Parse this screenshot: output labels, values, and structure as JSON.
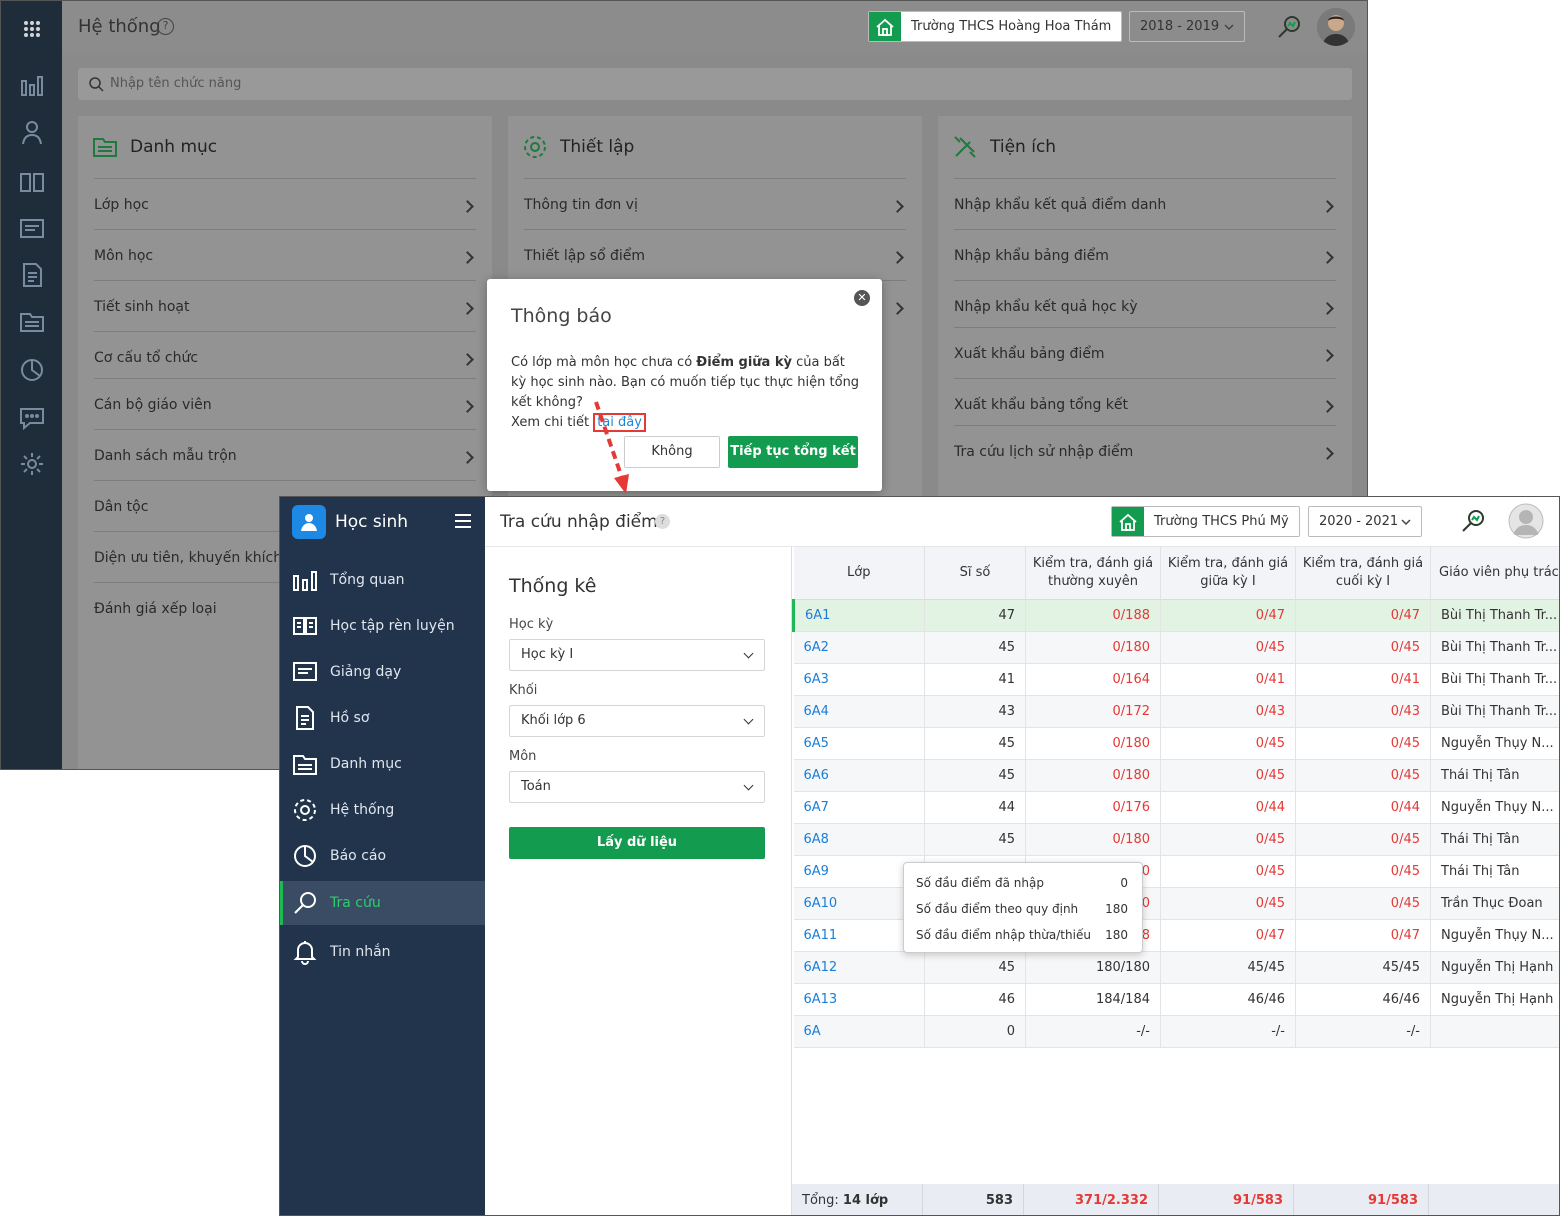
{
  "back": {
    "title": "Hệ thống",
    "help_glyph": "?",
    "school": "Trường THCS Hoàng Hoa Thám",
    "year": "2018 - 2019",
    "search_placeholder": "Nhập tên chức năng",
    "cards": [
      {
        "title": "Danh mục",
        "icon": "folder-icon",
        "items": [
          "Lớp học",
          "Môn học",
          "Tiết sinh hoạt",
          "Cơ cấu tổ chức",
          "Cán bộ giáo viên",
          "Danh sách mẫu trộn",
          "Dân tộc",
          "Diện ưu tiên, khuyến khích",
          "Đánh giá xếp loại"
        ]
      },
      {
        "title": "Thiết lập",
        "icon": "gear-icon",
        "items": [
          "Thông tin đơn vị",
          "Thiết lập sổ điểm"
        ]
      },
      {
        "title": "Tiện ích",
        "icon": "tools-icon",
        "items": [
          "Nhập khẩu kết quả điểm danh",
          "Nhập khẩu bảng điểm",
          "Nhập khẩu kết quả học kỳ",
          "Xuất khẩu bảng điểm",
          "Xuất khẩu bảng tổng kết",
          "Tra cứu lịch sử nhập điểm"
        ]
      }
    ]
  },
  "dialog": {
    "title": "Thông báo",
    "close_glyph": "✕",
    "msg_1": "Có lớp mà môn học chưa có ",
    "msg_bold": "Điểm giữa kỳ",
    "msg_2": " của bất kỳ học sinh nào. Bạn có muốn tiếp tục thực hiện tổng kết không?",
    "msg_3": "Xem chi tiết ",
    "link": "tại đây",
    "btn_no": "Không",
    "btn_yes": "Tiếp tục tổng kết"
  },
  "front": {
    "brand": "Học sinh",
    "nav": [
      {
        "label": "Tổng quan",
        "icon": "chart-icon"
      },
      {
        "label": "Học tập rèn luyện",
        "icon": "book-icon"
      },
      {
        "label": "Giảng dạy",
        "icon": "board-icon"
      },
      {
        "label": "Hồ sơ",
        "icon": "document-icon"
      },
      {
        "label": "Danh mục",
        "icon": "folder-icon"
      },
      {
        "label": "Hệ thống",
        "icon": "gear-icon"
      },
      {
        "label": "Báo cáo",
        "icon": "pie-icon"
      },
      {
        "label": "Tra cứu",
        "icon": "search-icon",
        "active": true
      },
      {
        "label": "Tin nhắn",
        "icon": "bell-icon"
      }
    ],
    "page_title": "Tra cứu nhập điểm",
    "help_glyph": "?",
    "school": "Trường THCS Phú Mỹ",
    "year": "2020 - 2021",
    "stats": {
      "title": "Thống kê",
      "term_label": "Học kỳ",
      "term_value": "Học kỳ I",
      "grade_label": "Khối",
      "grade_value": "Khối lớp 6",
      "subject_label": "Môn",
      "subject_value": "Toán",
      "fetch_btn": "Lấy dữ liệu"
    },
    "table": {
      "headers": [
        "Lớp",
        "Sĩ số",
        "Kiểm tra, đánh giá thường xuyên",
        "Kiểm tra, đánh giá giữa kỳ I",
        "Kiểm tra, đánh giá cuối kỳ I",
        "Giáo viên phụ trác"
      ],
      "rows": [
        {
          "lop": "6A1",
          "siso": "47",
          "tx": "0/188",
          "gk": "0/47",
          "ck": "0/47",
          "gv": "Bùi Thị Thanh Tr...",
          "warn": true
        },
        {
          "lop": "6A2",
          "siso": "45",
          "tx": "0/180",
          "gk": "0/45",
          "ck": "0/45",
          "gv": "Bùi Thị Thanh Tr...",
          "warn": true
        },
        {
          "lop": "6A3",
          "siso": "41",
          "tx": "0/164",
          "gk": "0/41",
          "ck": "0/41",
          "gv": "Bùi Thị Thanh Tr...",
          "warn": true
        },
        {
          "lop": "6A4",
          "siso": "43",
          "tx": "0/172",
          "gk": "0/43",
          "ck": "0/43",
          "gv": "Bùi Thị Thanh Tr...",
          "warn": true
        },
        {
          "lop": "6A5",
          "siso": "45",
          "tx": "0/180",
          "gk": "0/45",
          "ck": "0/45",
          "gv": "Nguyễn Thụy N...",
          "warn": true
        },
        {
          "lop": "6A6",
          "siso": "45",
          "tx": "0/180",
          "gk": "0/45",
          "ck": "0/45",
          "gv": "Thái Thị Tân",
          "warn": true
        },
        {
          "lop": "6A7",
          "siso": "44",
          "tx": "0/176",
          "gk": "0/44",
          "ck": "0/44",
          "gv": "Nguyễn Thụy N...",
          "warn": true
        },
        {
          "lop": "6A8",
          "siso": "45",
          "tx": "0/180",
          "gk": "0/45",
          "ck": "0/45",
          "gv": "Thái Thị Tân",
          "warn": true
        },
        {
          "lop": "6A9",
          "siso": "",
          "tx": "0",
          "gk": "0/45",
          "ck": "0/45",
          "gv": "Thái Thị Tân",
          "warn": true
        },
        {
          "lop": "6A10",
          "siso": "",
          "tx": "0",
          "gk": "0/45",
          "ck": "0/45",
          "gv": "Trần Thục Đoan",
          "warn": true
        },
        {
          "lop": "6A11",
          "siso": "",
          "tx": "8",
          "gk": "0/47",
          "ck": "0/47",
          "gv": "Nguyễn Thụy N...",
          "warn": true
        },
        {
          "lop": "6A12",
          "siso": "45",
          "tx": "180/180",
          "gk": "45/45",
          "ck": "45/45",
          "gv": "Nguyễn Thị Hạnh",
          "warn": false
        },
        {
          "lop": "6A13",
          "siso": "46",
          "tx": "184/184",
          "gk": "46/46",
          "ck": "46/46",
          "gv": "Nguyễn Thị Hạnh",
          "warn": false
        },
        {
          "lop": "6A",
          "siso": "0",
          "tx": "-/-",
          "gk": "-/-",
          "ck": "-/-",
          "gv": "",
          "warn": false
        }
      ],
      "footer_label": "Tổng: ",
      "footer_count": "14 lớp",
      "footer_siso": "583",
      "footer_tx": "371/2.332",
      "footer_gk": "91/583",
      "footer_ck": "91/583"
    },
    "tooltip": [
      {
        "label": "Số đầu điểm đã nhập",
        "value": "0"
      },
      {
        "label": "Số đầu điểm theo quy định",
        "value": "180"
      },
      {
        "label": "Số đầu điểm nhập thừa/thiếu",
        "value": "180"
      }
    ]
  },
  "colors": {
    "green": "#139c4f",
    "sidebar": "#22344b",
    "red": "#e53935",
    "link": "#1a7ed8"
  }
}
